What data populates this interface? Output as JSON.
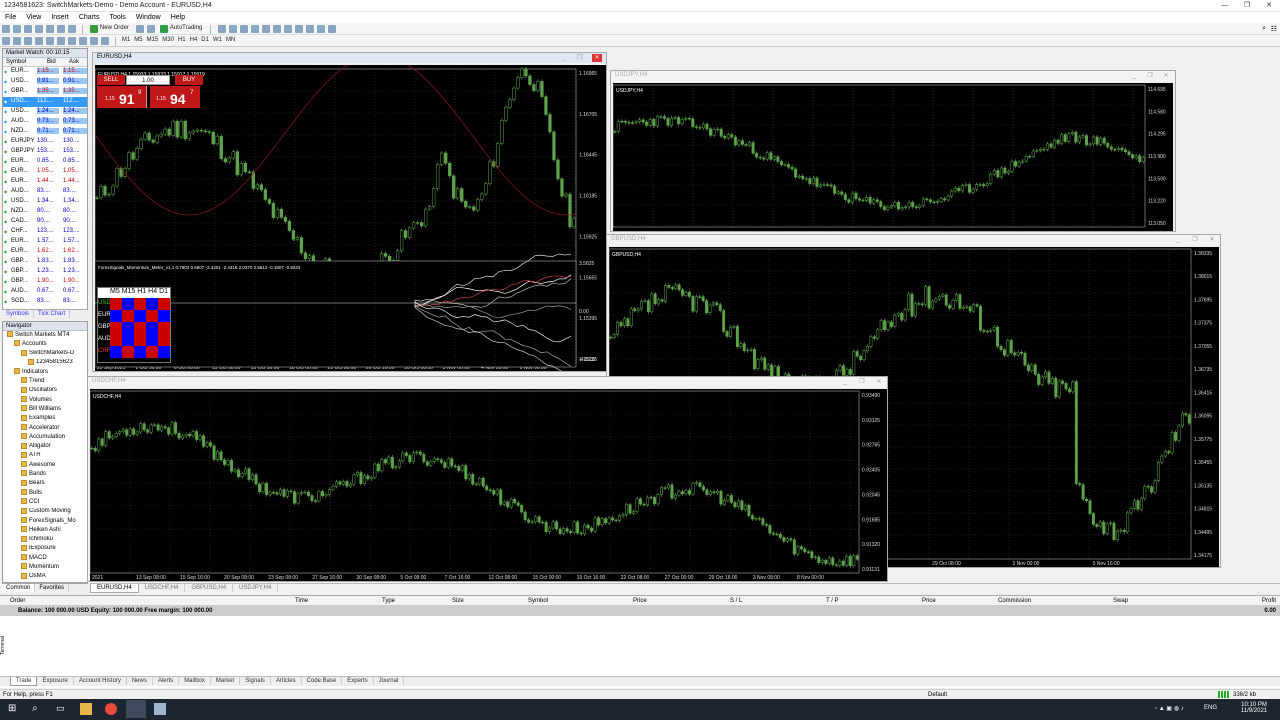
{
  "window": {
    "title": "1234581623: SwitchMarkets-Demo - Demo Account - EURUSD,H4"
  },
  "menu": [
    "File",
    "View",
    "Insert",
    "Charts",
    "Tools",
    "Window",
    "Help"
  ],
  "toolbar": {
    "new_order": "New Order",
    "autotrading": "AutoTrading",
    "timeframes": [
      "M1",
      "M5",
      "M15",
      "M30",
      "H1",
      "H4",
      "D1",
      "W1",
      "MN"
    ]
  },
  "market_watch": {
    "title": "Market Watch: 00:10:15",
    "cols": [
      "Symbol",
      "Bid",
      "Ask"
    ],
    "rows": [
      {
        "s": "EUR...",
        "b": "1.15...",
        "a": "1.15..."
      },
      {
        "s": "USD...",
        "b": "0.91...",
        "a": "0.91..."
      },
      {
        "s": "GBP...",
        "b": "1.35...",
        "a": "1.35..."
      },
      {
        "s": "USD...",
        "b": "112....",
        "a": "112...."
      },
      {
        "s": "USD...",
        "b": "1.24...",
        "a": "1.24..."
      },
      {
        "s": "AUD...",
        "b": "0.73...",
        "a": "0.73..."
      },
      {
        "s": "NZD...",
        "b": "0.71...",
        "a": "0.71..."
      },
      {
        "s": "EURJPY",
        "b": "130....",
        "a": "130...."
      },
      {
        "s": "GBPJPY",
        "b": "153....",
        "a": "153...."
      },
      {
        "s": "EUR...",
        "b": "0.85...",
        "a": "0.85..."
      },
      {
        "s": "EUR...",
        "b": "1.05...",
        "a": "1.05..."
      },
      {
        "s": "EUR...",
        "b": "1.44...",
        "a": "1.44..."
      },
      {
        "s": "AUD...",
        "b": "83....",
        "a": "83...."
      },
      {
        "s": "USD...",
        "b": "1.34...",
        "a": "1.34..."
      },
      {
        "s": "NZD...",
        "b": "80....",
        "a": "80...."
      },
      {
        "s": "CAD...",
        "b": "90....",
        "a": "90...."
      },
      {
        "s": "CHF...",
        "b": "123....",
        "a": "123...."
      },
      {
        "s": "EUR...",
        "b": "1.57...",
        "a": "1.57..."
      },
      {
        "s": "EUR...",
        "b": "1.62...",
        "a": "1.62..."
      },
      {
        "s": "GBP...",
        "b": "1.83...",
        "a": "1.83..."
      },
      {
        "s": "GBP...",
        "b": "1.23...",
        "a": "1.23..."
      },
      {
        "s": "GBP...",
        "b": "1.90...",
        "a": "1.90..."
      },
      {
        "s": "AUD...",
        "b": "0.67...",
        "a": "0.67..."
      },
      {
        "s": "SGD...",
        "b": "83....",
        "a": "83...."
      }
    ],
    "tabs": [
      "Symbols",
      "Tick Chart"
    ]
  },
  "navigator": {
    "title": "Navigator",
    "items": [
      {
        "t": "Switch Markets MT4",
        "d": 0
      },
      {
        "t": "Accounts",
        "d": 1
      },
      {
        "t": "SwitchMarkets-D",
        "d": 2
      },
      {
        "t": "12345815623",
        "d": 3
      },
      {
        "t": "Indicators",
        "d": 1
      },
      {
        "t": "Trend",
        "d": 2
      },
      {
        "t": "Oscillators",
        "d": 2
      },
      {
        "t": "Volumes",
        "d": 2
      },
      {
        "t": "Bill Williams",
        "d": 2
      },
      {
        "t": "Examples",
        "d": 2
      },
      {
        "t": "Accelerator",
        "d": 2
      },
      {
        "t": "Accumulation",
        "d": 2
      },
      {
        "t": "Alligator",
        "d": 2
      },
      {
        "t": "ATR",
        "d": 2
      },
      {
        "t": "Awesome",
        "d": 2
      },
      {
        "t": "Bands",
        "d": 2
      },
      {
        "t": "Bears",
        "d": 2
      },
      {
        "t": "Bulls",
        "d": 2
      },
      {
        "t": "CCI",
        "d": 2
      },
      {
        "t": "Custom Moving",
        "d": 2
      },
      {
        "t": "ForexSignals_Mo",
        "d": 2
      },
      {
        "t": "Heiken Ashi",
        "d": 2
      },
      {
        "t": "Ichimoku",
        "d": 2
      },
      {
        "t": "iExposure",
        "d": 2
      },
      {
        "t": "MACD",
        "d": 2
      },
      {
        "t": "Momentum",
        "d": 2
      },
      {
        "t": "OsMA",
        "d": 2
      }
    ],
    "tabs": [
      "Common",
      "Favorites"
    ]
  },
  "charts": [
    {
      "id": "eurusd",
      "title": "EURUSD,H4",
      "label": "EURUSD,H4  1.15933 1.15933 1.15917 1.15919",
      "sell": "SELL",
      "buy": "BUY",
      "lot": "1.00",
      "sell_pre": "1.15",
      "sell_big": "91",
      "sell_sup": "9",
      "buy_pre": "1.15",
      "buy_big": "94",
      "buy_sup": "7",
      "indicator": "ForexSignals_Momentum_Meter_v1.1 0.7603 0.6807 -3.4201 -2.4416 2.0370 2.5612 -0.1807 -0.8233",
      "meter_head": [
        "M5",
        "M15",
        "H1",
        "H4",
        "D1"
      ],
      "meter_rows": [
        "USD",
        "EUR",
        "GBP",
        "AUD",
        "CHF"
      ],
      "prices": [
        "1.16965",
        "1.16705",
        "1.16445",
        "1.16185",
        "1.15925",
        "1.15655",
        "1.15395",
        "1.15135",
        "3.5825",
        "-4.8132",
        "0.00"
      ],
      "dates": [
        "29 Sep 2021",
        "1 Oct 16:00",
        "6 Oct 08:00",
        "11 Oct 08:00",
        "13 Oct 16:00",
        "18 Oct 00:00",
        "21 Oct 08:00",
        "26 Oct 16:00",
        "28 Oct 00:00",
        "3 Nov 00:00",
        "4 Nov 16:00",
        "9 Nov 00:00"
      ]
    },
    {
      "id": "usdjpy",
      "title": "USDJPY,H4",
      "label": "USDJPY,H4",
      "prices": [
        "114.695",
        "114.580",
        "114.295",
        "113.900",
        "113.590",
        "113.220",
        "113.050"
      ]
    },
    {
      "id": "gbpusd",
      "title": "GBPUSD,H4",
      "label": "GBPUSD,H4",
      "prices": [
        "1.38335",
        "1.38015",
        "1.37695",
        "1.37375",
        "1.37055",
        "1.36735",
        "1.36415",
        "1.36095",
        "1.35775",
        "1.35455",
        "1.35135",
        "1.34815",
        "1.34495",
        "1.34175"
      ],
      "dates": [
        "14 Oct 16:00",
        "18 Oct 16:00",
        "22 Oct 08:00",
        "26 Oct 16:00",
        "29 Oct 08:00",
        "3 Nov 00:00",
        "5 Nov 16:00"
      ]
    },
    {
      "id": "usdchf",
      "title": "USDCHF,H4",
      "label": "USDCHF,H4",
      "prices": [
        "0.93490",
        "0.93125",
        "0.92765",
        "0.92405",
        "0.92045",
        "0.91685",
        "0.91320",
        "0.91131"
      ],
      "dates": [
        "2021",
        "13 Sep 08:00",
        "15 Sep 16:00",
        "20 Sep 08:00",
        "23 Sep 08:00",
        "27 Sep 16:00",
        "30 Sep 08:00",
        "5 Oct 08:00",
        "7 Oct 16:00",
        "12 Oct 08:00",
        "15 Oct 00:00",
        "19 Oct 16:00",
        "22 Oct 08:00",
        "27 Oct 00:00",
        "29 Oct 16:00",
        "3 Nov 08:00",
        "8 Nov 00:00"
      ]
    }
  ],
  "chart_tabs": [
    "EURUSD,H4",
    "USDCHF,H4",
    "GBPUSD,H4",
    "USDJPY,H4"
  ],
  "terminal": {
    "cols": [
      "Order",
      "Time",
      "Type",
      "Size",
      "Symbol",
      "Price",
      "S / L",
      "T / P",
      "Price",
      "Commission",
      "Swap",
      "Profit"
    ],
    "balance": "Balance: 100 000.00 USD   Equity: 100 000.00   Free margin: 100 000.00",
    "balance_profit": "0.00",
    "tabs": [
      "Trade",
      "Exposure",
      "Account History",
      "News",
      "Alerts",
      "Mailbox",
      "Market",
      "Signals",
      "Articles",
      "Code Base",
      "Experts",
      "Journal"
    ],
    "side": "Terminal"
  },
  "status": {
    "left": "For Help, press F1",
    "mid": "Default",
    "right": "336/2 kb"
  },
  "taskbar": {
    "lang": "ENG",
    "time": "10:10 PM",
    "date": "11/9/2021"
  }
}
